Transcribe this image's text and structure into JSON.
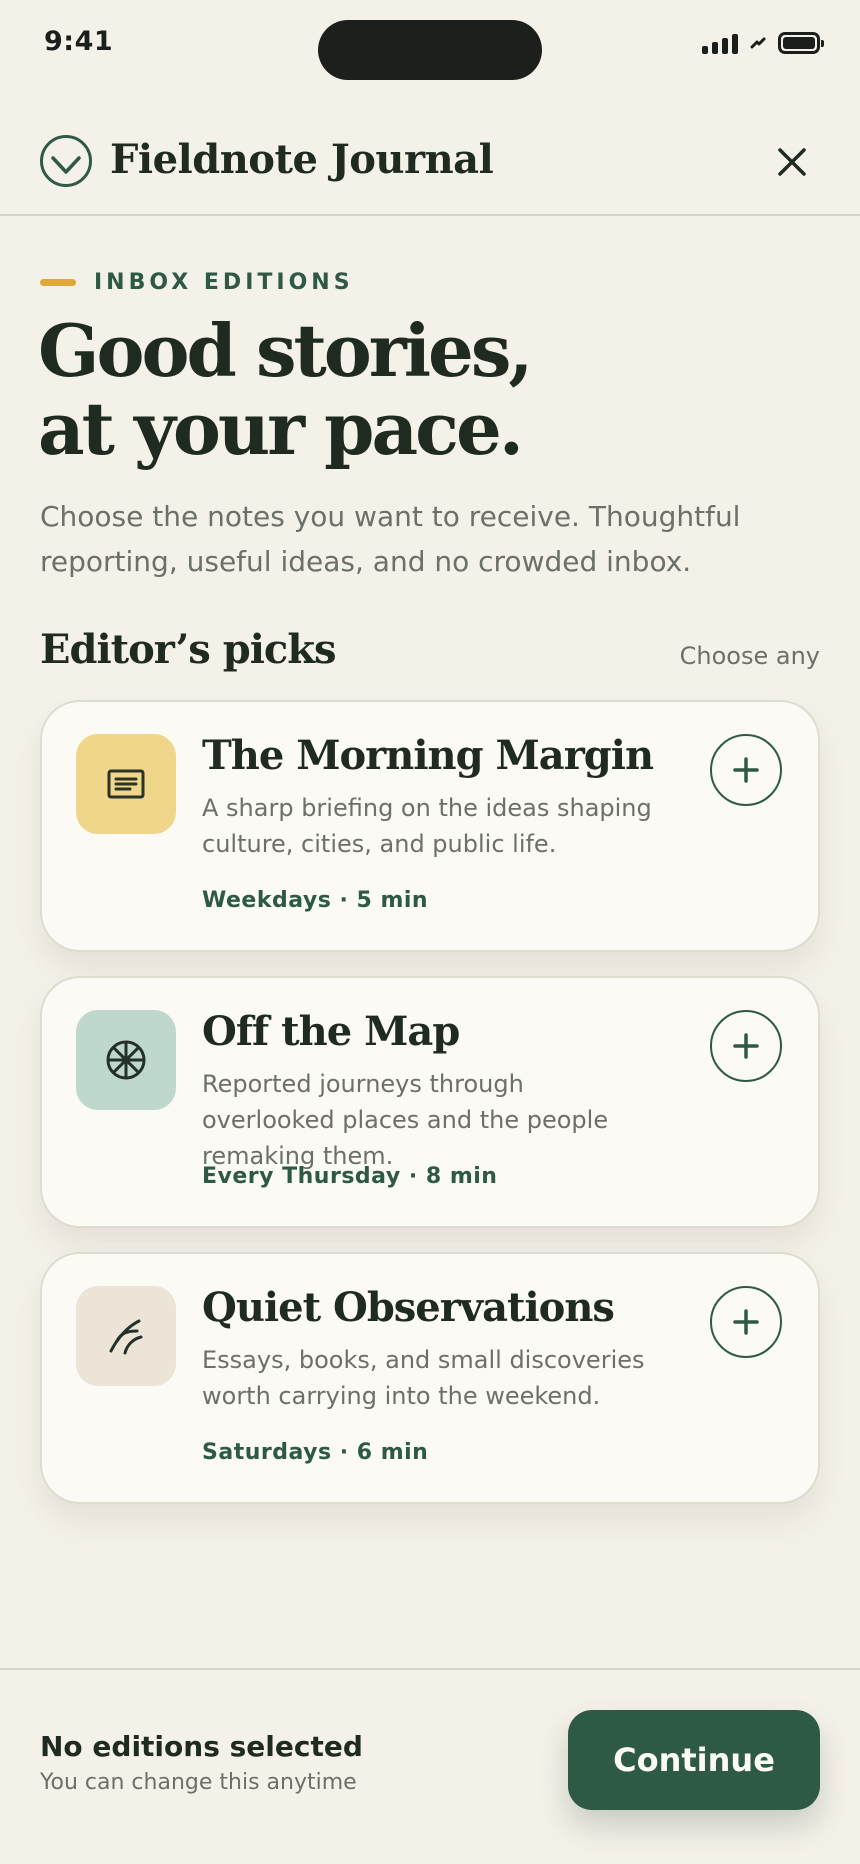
{
  "status_bar": {
    "time": "9:41"
  },
  "header": {
    "title": "Fieldnote Journal"
  },
  "intro": {
    "eyebrow": "INBOX EDITIONS",
    "headline_line1": "Good stories,",
    "headline_line2": "at your pace.",
    "body": "Choose the notes you want to receive. Thoughtful reporting, useful ideas, and no crowded inbox."
  },
  "section": {
    "title": "Editor’s picks",
    "hint": "Choose any"
  },
  "editions": [
    {
      "title": "The Morning Margin",
      "description": "A sharp briefing on the ideas shaping culture, cities, and public life.",
      "meta": "Weekdays · 5 min",
      "icon": "newspaper-icon",
      "icon_bg": "#f0d68a"
    },
    {
      "title": "Off the Map",
      "description": "Reported journeys through overlooked places and the people remaking them.",
      "meta": "Every Thursday · 8 min",
      "icon": "compass-wheel-icon",
      "icon_bg": "#bfd8cd"
    },
    {
      "title": "Quiet Observations",
      "description": "Essays, books, and small discoveries worth carrying into the weekend.",
      "meta": "Saturdays · 6 min",
      "icon": "leaf-sprig-icon",
      "icon_bg": "#ece4d6"
    }
  ],
  "footer": {
    "status": "No editions selected",
    "sub": "You can change this anytime",
    "continue_label": "Continue"
  },
  "colors": {
    "background": "#f4f1e8",
    "accent": "#2e5a45",
    "eyebrow_bar": "#e0a83a",
    "card": "#fbfaf4"
  }
}
